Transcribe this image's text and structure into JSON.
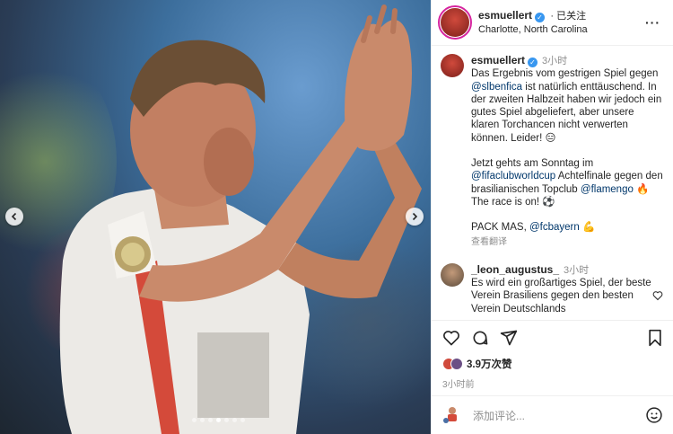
{
  "post": {
    "author": "esmuellert",
    "follow_label": "· 已关注",
    "location": "Charlotte, North Carolina",
    "more_label": "···"
  },
  "caption": {
    "author": "esmuellert",
    "time": "3小时",
    "para1_pre": "Das Ergebnis vom gestrigen Spiel gegen ",
    "para1_mention": "@slbenfica",
    "para1_post": " ist natürlich enttäuschend. In der zweiten Halbzeit haben wir jedoch ein gutes Spiel abgeliefert, aber unsere klaren Torchancen nicht verwerten können. Leider! 😑",
    "para2_pre": "Jetzt gehts am Sonntag im ",
    "para2_mention1": "@fifaclubworldcup",
    "para2_mid": " Achtelfinale gegen den brasilianischen Topclub ",
    "para2_mention2": "@flamengo",
    "para2_post": " 🔥The race is on! ⚽",
    "para3_pre": "PACK MAS, ",
    "para3_mention": "@fcbayern",
    "para3_post": " 💪",
    "translate_label": "查看翻译"
  },
  "comment": {
    "author": "_leon_augustus_",
    "time": "3小时",
    "text": "Es wird ein großartiges Spiel, der beste Verein Brasiliens gegen den besten Verein Deutschlands"
  },
  "stats": {
    "likes": "3.9万次赞",
    "posted": "3小时前"
  },
  "composer": {
    "placeholder": "添加评论..."
  },
  "carousel": {
    "slide_count": 7,
    "active_index": 3
  }
}
